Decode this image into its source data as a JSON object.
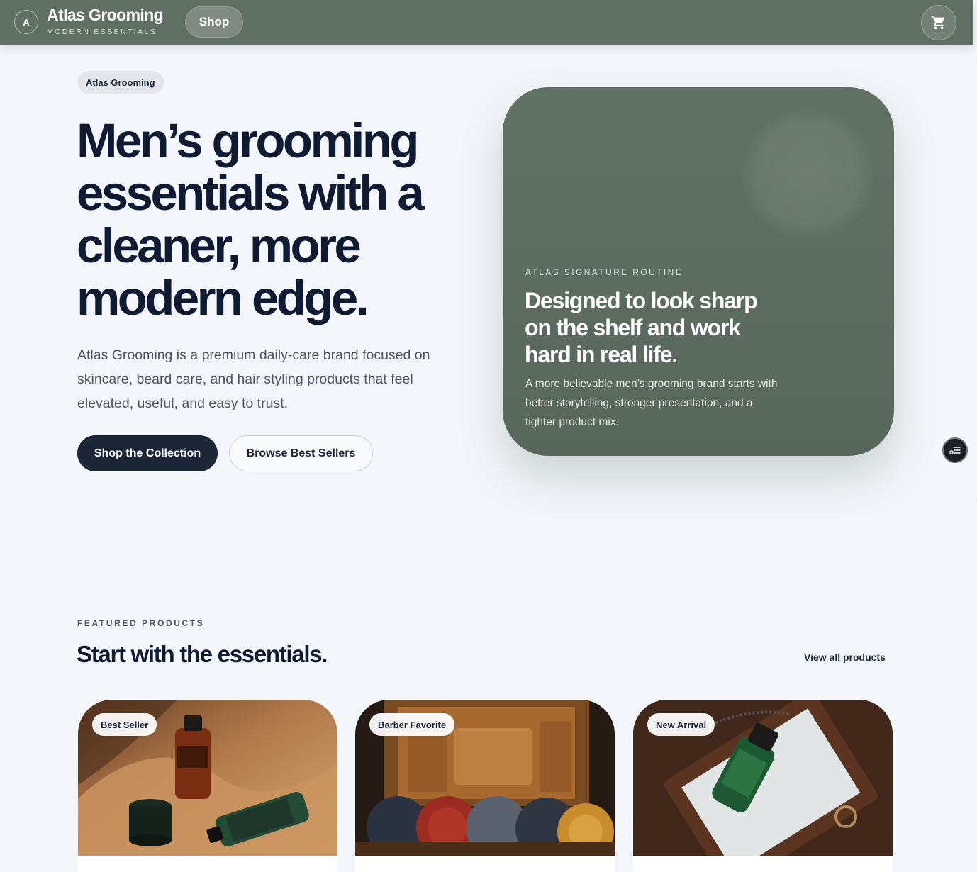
{
  "header": {
    "logo_letter": "A",
    "brand_name": "Atlas Grooming",
    "brand_tagline": "MODERN ESSENTIALS",
    "nav_shop": "Shop",
    "cart_icon": "cart-icon",
    "bar_color": "#5f6f63"
  },
  "hero": {
    "chip": "Atlas Grooming",
    "title": "Men’s grooming essentials with a cleaner, more modern edge.",
    "description": "Atlas Grooming is a premium daily-care brand focused on skincare, beard care, and hair styling products that feel elevated, useful, and easy to trust.",
    "primary_cta": "Shop the Collection",
    "secondary_cta": "Browse Best Sellers"
  },
  "hero_card": {
    "eyebrow": "ATLAS SIGNATURE ROUTINE",
    "title": "Designed to look sharp on the shelf and work hard in real life.",
    "description": "A more believable men’s grooming brand starts with better storytelling, stronger presentation, and a tighter product mix."
  },
  "featured": {
    "eyebrow": "FEATURED PRODUCTS",
    "title": "Start with the essentials.",
    "view_all": "View all products",
    "products": [
      {
        "badge": "Best Seller"
      },
      {
        "badge": "Barber Favorite"
      },
      {
        "badge": "New Arrival"
      }
    ]
  },
  "floating_widget": {
    "icon": "menu-list-icon"
  }
}
